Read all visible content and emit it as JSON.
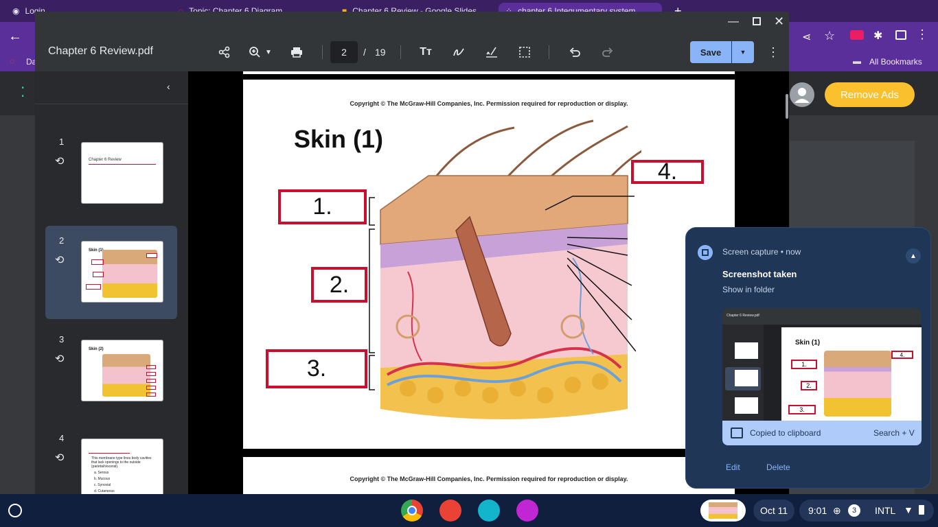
{
  "browser": {
    "tabs": [
      {
        "label": "Login"
      },
      {
        "label": "Topic: Chapter 6 Diagram"
      },
      {
        "label": "Chapter 6 Review - Google Slides"
      },
      {
        "label": "chapter 6 Integumentary system"
      }
    ],
    "bookmarks": {
      "left_label": "Da",
      "all_bookmarks": "All Bookmarks"
    }
  },
  "page": {
    "remove_ads": "Remove Ads"
  },
  "pdf": {
    "title": "Chapter 6 Review.pdf",
    "current_page": "2",
    "page_sep": "/",
    "total_pages": "19",
    "save_label": "Save",
    "thumbnails": [
      {
        "num": "1",
        "caption": "Chapter 6 Review"
      },
      {
        "num": "2",
        "caption": "Skin (1)"
      },
      {
        "num": "3",
        "caption": "Skin (2)"
      },
      {
        "num": "4",
        "lines": [
          "This membrane type lines body cavities that lack openings to the outside (parietal/visceral).",
          "a. Serous",
          "b. Mucous",
          "c. Synovial",
          "d. Cutaneous"
        ]
      }
    ],
    "page_content": {
      "copyright": "Copyright © The McGraw-Hill Companies, Inc. Permission required for reproduction or display.",
      "title": "Skin (1)",
      "labels": [
        "1.",
        "2.",
        "3.",
        "4."
      ]
    }
  },
  "notification": {
    "app": "Screen capture",
    "dot": "•",
    "time": "now",
    "title": "Screenshot taken",
    "subtitle": "Show in folder",
    "clipboard": "Copied to clipboard",
    "shortcut": "Search + V",
    "edit": "Edit",
    "delete": "Delete",
    "preview": {
      "title": "Skin (1)",
      "file": "Chapter 6 Review.pdf",
      "labels": [
        "1.",
        "2.",
        "3.",
        "4."
      ]
    }
  },
  "shelf": {
    "date": "Oct 11",
    "time": "9:01",
    "notif_count": "3",
    "ime": "INTL"
  },
  "colors": {
    "accent": "#8ab4f8",
    "label_red": "#c8102e",
    "remove_ads": "#fbc02d",
    "browser_purple": "#5a2f9a"
  }
}
